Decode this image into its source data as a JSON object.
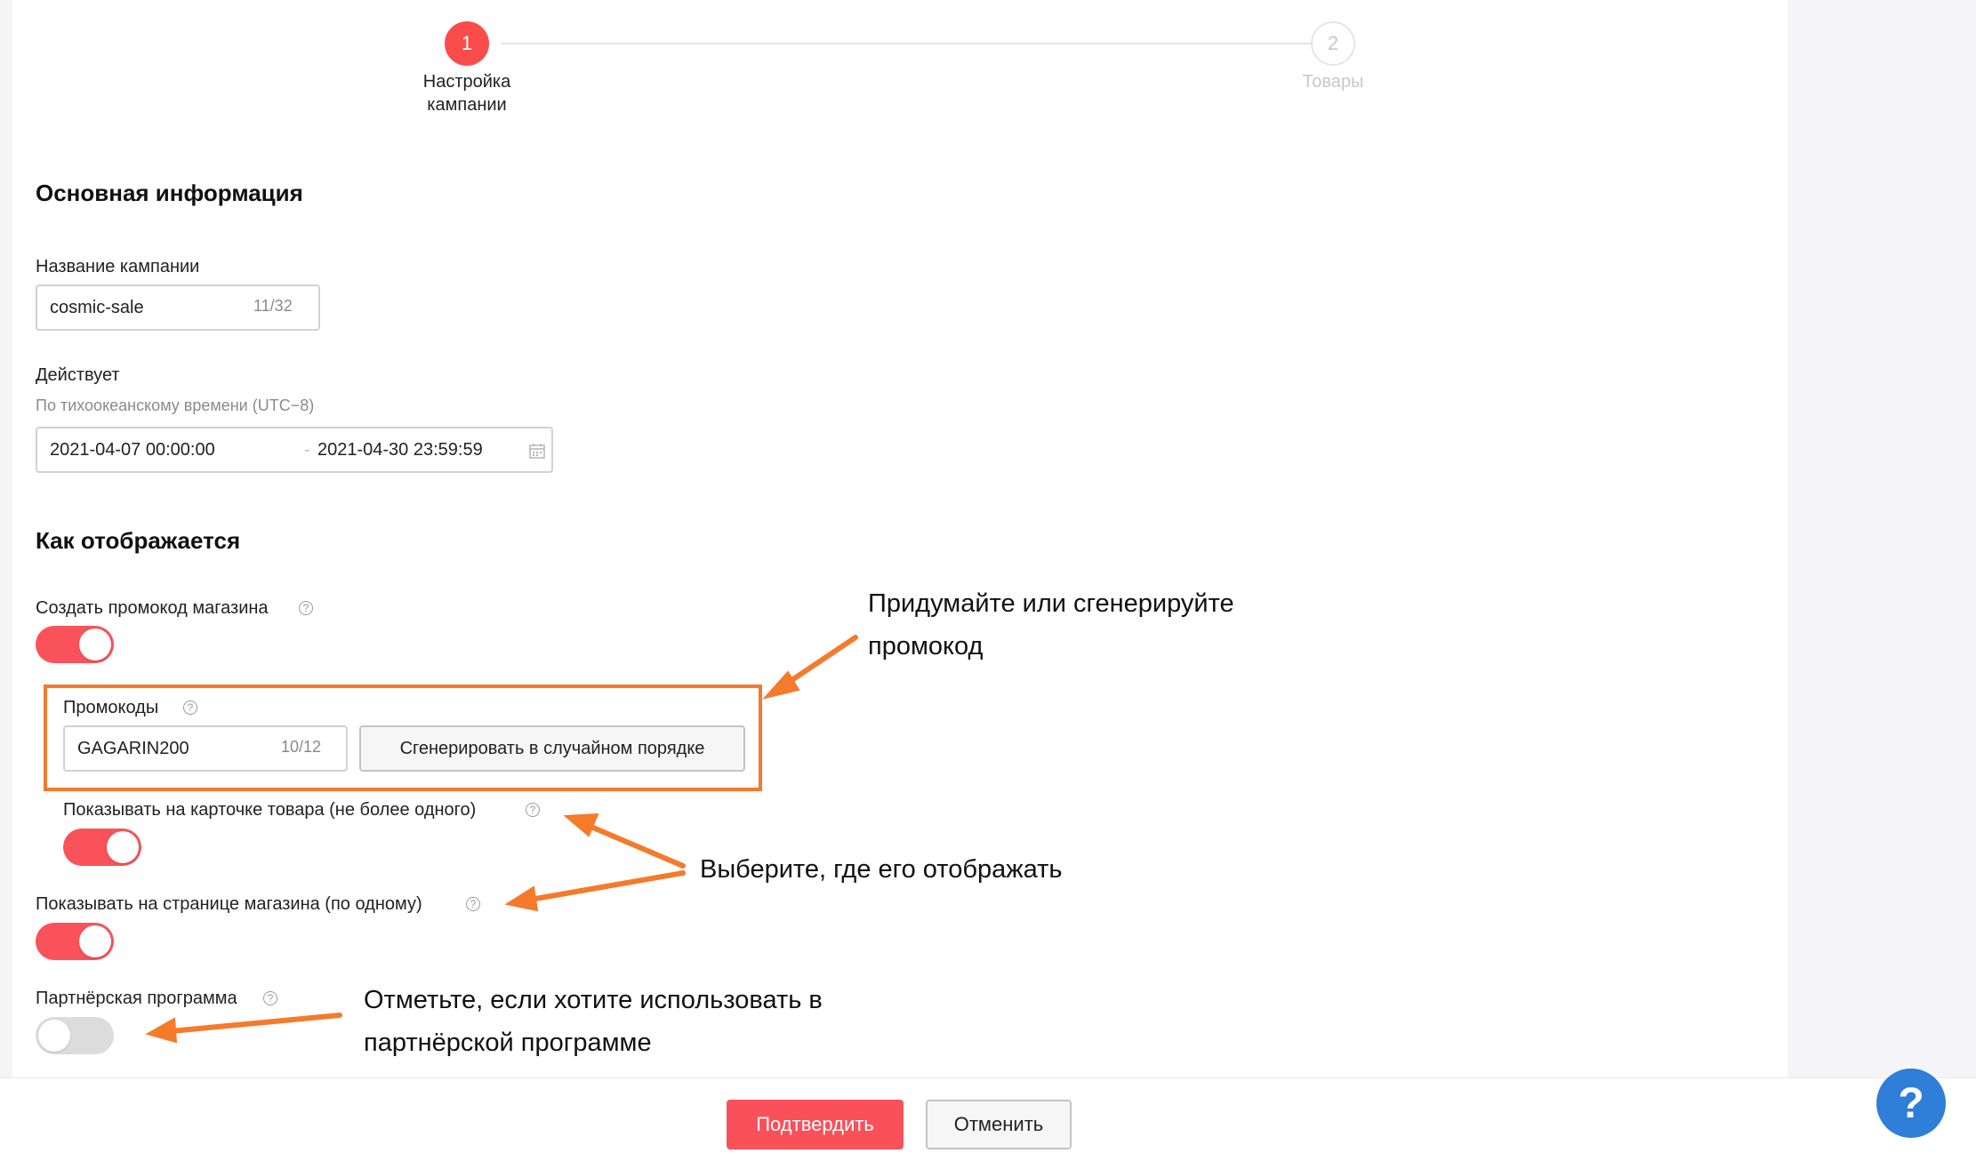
{
  "stepper": {
    "step1": {
      "number": "1",
      "label_line1": "Настройка",
      "label_line2": "кампании"
    },
    "step2": {
      "number": "2",
      "label": "Товары"
    }
  },
  "basic_info": {
    "heading": "Основная информация",
    "campaign_name": {
      "label": "Название кампании",
      "value": "cosmic-sale",
      "counter": "11/32"
    },
    "validity": {
      "label": "Действует",
      "hint": "По тихоокеанскому времени (UTC−8)",
      "start": "2021-04-07 00:00:00",
      "separator": "-",
      "end": "2021-04-30 23:59:59"
    }
  },
  "display": {
    "heading": "Как отображается",
    "create_promo": {
      "label": "Создать промокод магазина",
      "enabled": true
    },
    "promo_codes": {
      "label": "Промокоды",
      "value": "GAGARIN200",
      "counter": "10/12",
      "generate_button": "Сгенерировать в случайном порядке"
    },
    "show_on_product": {
      "label": "Показывать на карточке товара (не более одного)",
      "enabled": true
    },
    "show_on_store": {
      "label": "Показывать на странице магазина (по одному)",
      "enabled": true
    },
    "affiliate": {
      "label": "Партнёрская программа",
      "enabled": false
    }
  },
  "annotations": {
    "promo_line1": "Придумайте или сгенерируйте",
    "promo_line2": "промокод",
    "where": "Выберите, где его отображать",
    "affiliate_line1": "Отметьте, если хотите использовать в",
    "affiliate_line2": "партнёрской программе"
  },
  "footer": {
    "confirm": "Подтвердить",
    "cancel": "Отменить"
  },
  "help_fab": "?",
  "colors": {
    "accent": "#f9505a",
    "annotation": "#f57a2a",
    "help": "#2f7ed8"
  },
  "icons": {
    "calendar": "calendar-icon",
    "help": "question-circle-icon"
  }
}
